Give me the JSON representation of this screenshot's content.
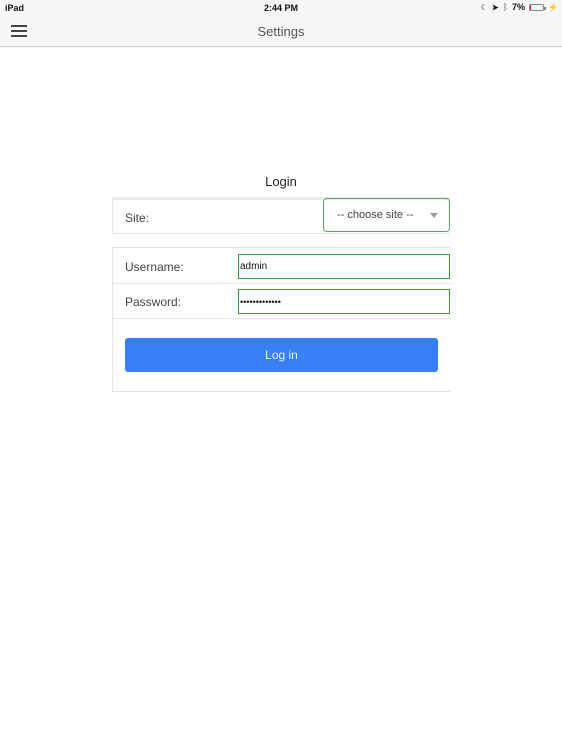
{
  "status_bar": {
    "device": "iPad",
    "time": "2:44 PM",
    "battery_text": "7%",
    "battery_level_percent": 7,
    "icons": [
      "moon-icon",
      "location-arrow-icon",
      "bluetooth-icon",
      "battery-icon",
      "charging-bolt-icon"
    ]
  },
  "navbar": {
    "menu_icon": "hamburger-icon",
    "title": "Settings"
  },
  "login": {
    "title": "Login",
    "site": {
      "label": "Site:",
      "selected": "-- choose site --"
    },
    "username": {
      "label": "Username:",
      "value": "admin"
    },
    "password": {
      "label": "Password:",
      "value": "•••••••••••••"
    },
    "submit_label": "Log in",
    "accent_color": "#3880f5",
    "field_border_color": "#3a9a3a"
  }
}
